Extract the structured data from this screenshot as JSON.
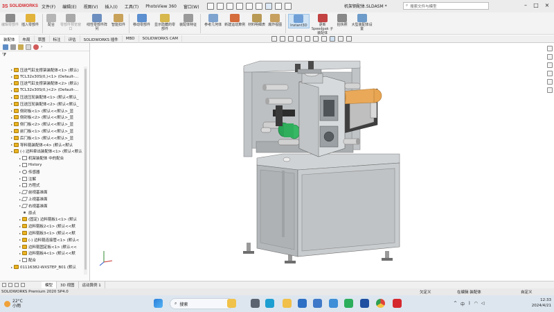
{
  "app": {
    "brand": "SOLIDWORKS",
    "document_title": "机架钢配体.SLDASM *"
  },
  "menu": [
    "文件(F)",
    "编辑(E)",
    "视图(V)",
    "插入(I)",
    "工具(T)",
    "PhotoView 360",
    "窗口(W)"
  ],
  "search": {
    "placeholder": "搜索文件与模型"
  },
  "ribbon": [
    {
      "label": "编辑零部件",
      "grey": true,
      "color": "#8a8a8a"
    },
    {
      "label": "插入零部件",
      "grey": false,
      "color": "#e2b33b"
    },
    {
      "label": "配合",
      "grey": false,
      "color": "#b5b5b5"
    },
    {
      "label": "零部件预览窗口",
      "grey": true,
      "color": "#a9a9a9"
    },
    {
      "label": "线性零部件阵列",
      "grey": false,
      "color": "#6d8fc0"
    },
    {
      "label": "智能扣件",
      "grey": false,
      "color": "#c9a25a"
    },
    {
      "label": "移动零部件",
      "grey": false,
      "color": "#5b8fd0"
    },
    {
      "label": "显示隐藏的零部件",
      "grey": false,
      "color": "#d7b84d"
    },
    {
      "label": "装配体特征",
      "grey": false,
      "color": "#9a9a9a"
    },
    {
      "label": "参考几何体",
      "grey": false,
      "color": "#7ea3cf"
    },
    {
      "label": "新建运动算例",
      "grey": false,
      "color": "#d56c3c"
    },
    {
      "label": "材料明细表",
      "grey": false,
      "color": "#b89a55"
    },
    {
      "label": "爆炸视图",
      "grey": false,
      "color": "#c7a060"
    },
    {
      "label": "Instant3D",
      "grey": false,
      "color": "#6f9fd6",
      "active": true
    },
    {
      "label": "更新 Speedpak 子装配体",
      "grey": false,
      "color": "#c34343"
    },
    {
      "label": "拍快照",
      "grey": false,
      "color": "#888"
    },
    {
      "label": "大型装配体设置",
      "grey": false,
      "color": "#6d9bc9"
    }
  ],
  "cm_tabs": [
    "装配体",
    "布局",
    "草图",
    "标注",
    "评估",
    "SOLIDWORKS 插件",
    "MBD",
    "SOLIDWORKS CAM"
  ],
  "tree": [
    {
      "label": "压送气缸支撑架装配体<1> (默认)",
      "type": "asm",
      "indent": 1
    },
    {
      "label": "TCL32x30S(0,)<1> (Default-...",
      "type": "asm",
      "indent": 1
    },
    {
      "label": "压送气缸支撑架装配体<2> (默认)",
      "type": "asm",
      "indent": 1
    },
    {
      "label": "TCL32x30S(0,)<2> (Default-...",
      "type": "asm",
      "indent": 1
    },
    {
      "label": "压送压轮装配体<1> (默认<默认_",
      "type": "asm",
      "indent": 1
    },
    {
      "label": "压送压轮装配体<2> (默认<默认_",
      "type": "asm",
      "indent": 1
    },
    {
      "label": "侧封板<1> (默认<<默认>_显",
      "type": "asm",
      "indent": 1
    },
    {
      "label": "侧封板<2> (默认<<默认>_显",
      "type": "asm",
      "indent": 1
    },
    {
      "label": "侧门板<2> (默认<<默认>_显",
      "type": "asm",
      "indent": 1
    },
    {
      "label": "前门板<1> (默认<<默认>_显",
      "type": "asm",
      "indent": 1
    },
    {
      "label": "后门板<1> (默认<<默认>_显",
      "type": "asm",
      "indent": 1
    },
    {
      "label": "导料辊装配体<4> (默认<默认",
      "type": "asm",
      "indent": 1
    },
    {
      "label": "(-) 边料牵出装配体<1> (默认<默认",
      "type": "asm",
      "indent": 1,
      "expanded": true
    },
    {
      "label": "机架装配体 中的配合",
      "type": "doc",
      "indent": 2
    },
    {
      "label": "History",
      "type": "doc",
      "indent": 2
    },
    {
      "label": "传感器",
      "type": "sensor",
      "indent": 2
    },
    {
      "label": "注解",
      "type": "doc",
      "indent": 2
    },
    {
      "label": "方程式",
      "type": "doc",
      "indent": 2
    },
    {
      "label": "前视基准面",
      "type": "plane",
      "indent": 2
    },
    {
      "label": "上视基准面",
      "type": "plane",
      "indent": 2
    },
    {
      "label": "右视基准面",
      "type": "plane",
      "indent": 2
    },
    {
      "label": "原点",
      "type": "pt",
      "indent": 2
    },
    {
      "label": "(固定) 边料辊板1<1> (默认",
      "type": "asm",
      "indent": 2
    },
    {
      "label": "边料辊板2<1> (默认<<默",
      "type": "asm",
      "indent": 2
    },
    {
      "label": "边料辊板3<1> (默认<<默",
      "type": "asm",
      "indent": 2
    },
    {
      "label": "(-) 边料辊连接管<1> (默认<",
      "type": "asm",
      "indent": 2
    },
    {
      "label": "边料辊固定板<1> (默认<<",
      "type": "asm",
      "indent": 2
    },
    {
      "label": "边料辊板4<1> (默认<<默",
      "type": "asm",
      "indent": 2
    },
    {
      "label": "配合",
      "type": "doc",
      "indent": 2
    },
    {
      "label": "01116382-WXSTEP_B01 (默认",
      "type": "asm",
      "indent": 1
    }
  ],
  "bottom_tabs": [
    "模型",
    "3D 视图",
    "运动算例 1"
  ],
  "status": {
    "product": "SOLIDWORKS Premium 2020 SP4.0",
    "definition": "欠定义",
    "editing": "在编辑 装配体",
    "units": "自定义"
  },
  "taskbar": {
    "temp": "22°C",
    "weather": "小雨",
    "search": "搜索",
    "time": "12:33",
    "date": "2024/4/21",
    "lang": "中"
  },
  "colors": {
    "accent": "#d5282e",
    "asm_icon": "#e9b323",
    "active_ribbon": "#cfe3f5"
  }
}
